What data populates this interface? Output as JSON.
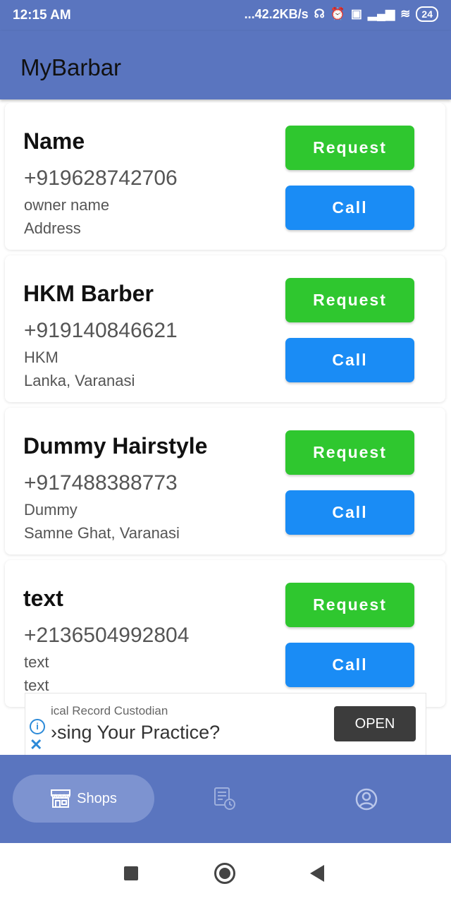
{
  "status_bar": {
    "time": "12:15 AM",
    "net_speed": "...42.2KB/s",
    "battery": "24"
  },
  "app_bar": {
    "title": "MyBarbar"
  },
  "shops": [
    {
      "name": "Name",
      "phone": "+919628742706",
      "owner": "owner name",
      "address": "Address",
      "request_label": "Request",
      "call_label": "Call"
    },
    {
      "name": "HKM Barber",
      "phone": "+919140846621",
      "owner": "HKM",
      "address": "Lanka, Varanasi",
      "request_label": "Request",
      "call_label": "Call"
    },
    {
      "name": "Dummy Hairstyle",
      "phone": "+917488388773",
      "owner": "Dummy",
      "address": "Samne Ghat, Varanasi",
      "request_label": "Request",
      "call_label": "Call"
    },
    {
      "name": "text",
      "phone": "+2136504992804",
      "owner": "text",
      "address": "text",
      "request_label": "Request",
      "call_label": "Call"
    }
  ],
  "ad": {
    "headline": "ical Record Custodian",
    "title": "›sing Your Practice?",
    "cta": "OPEN"
  },
  "bottom_nav": {
    "shops_label": "Shops"
  },
  "colors": {
    "primary": "#5a75bf",
    "request_green": "#2fc72f",
    "call_blue": "#1a8cf5"
  }
}
